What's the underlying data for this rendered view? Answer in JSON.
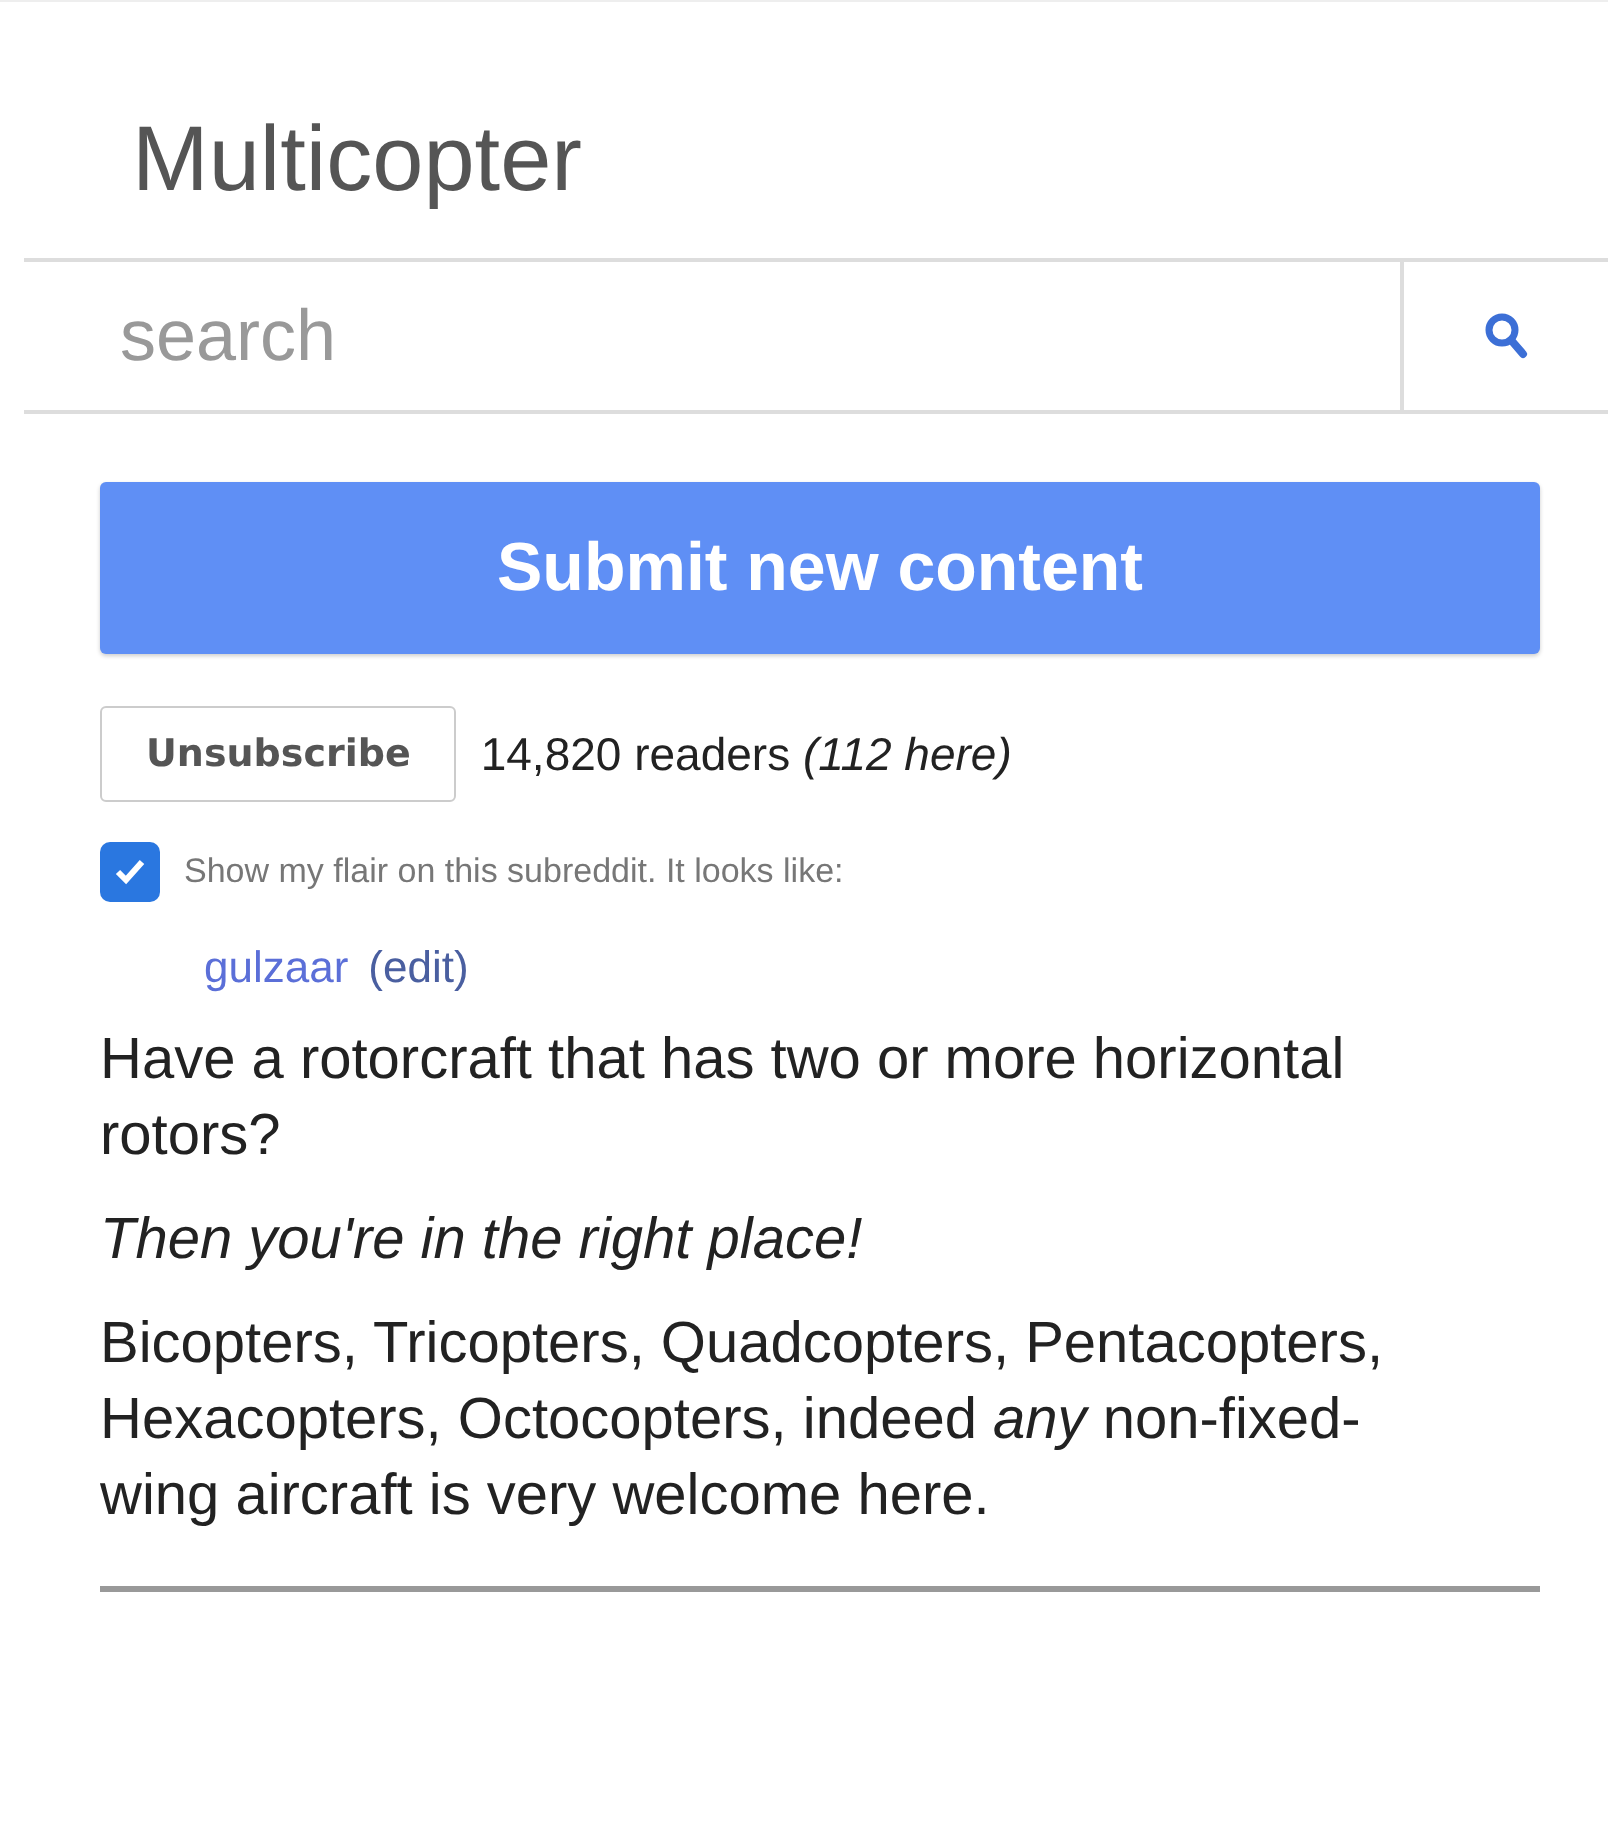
{
  "title": "Multicopter",
  "search": {
    "placeholder": "search"
  },
  "submit_button": "Submit new content",
  "subscribe_button": "Unsubscribe",
  "readers": "14,820 readers *(112 here)*",
  "flair": {
    "checked": true,
    "label": "Show my flair on this subreddit. It looks like:",
    "username": "gulzaar",
    "edit_link": "(edit)"
  },
  "description": [
    {
      "kind": "text",
      "text": "Have a rotorcraft that has two or more horizontal rotors?"
    },
    {
      "kind": "emphasis",
      "text": "Then you're in the right place!"
    },
    {
      "kind": "text",
      "text": "Bicopters, Tricopters, Quadcopters, Pentacopters, Hexacopters, Octocopters, indeed *any* non-fixed-wing aircraft is very welcome here."
    }
  ]
}
